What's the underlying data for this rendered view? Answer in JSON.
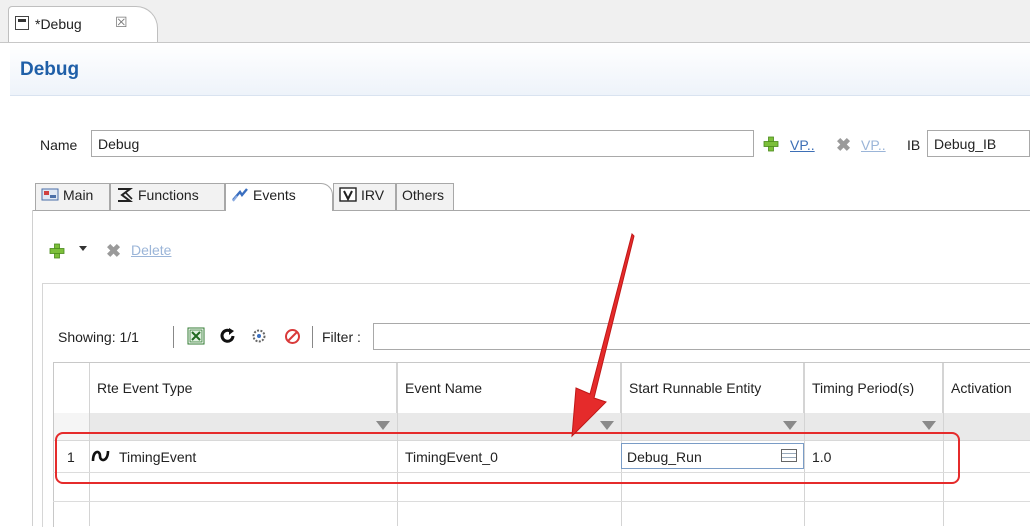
{
  "editor_tab": {
    "label": "*Debug",
    "close_glyph": "☒"
  },
  "title": "Debug",
  "name_row": {
    "name_label": "Name",
    "name_value": "Debug",
    "vp_add_link": "VP..",
    "vp_remove_link": "VP..",
    "ib_label": "IB",
    "ib_value": "Debug_IB"
  },
  "tabs": [
    {
      "label": "Main",
      "icon": "main-icon"
    },
    {
      "label": "Functions",
      "icon": "functions-icon"
    },
    {
      "label": "Events",
      "icon": "events-icon",
      "active": true
    },
    {
      "label": "IRV",
      "icon": "irv-icon"
    },
    {
      "label": "Others",
      "icon": ""
    }
  ],
  "actions": {
    "delete_label": "Delete"
  },
  "toolbar": {
    "showing": "Showing: 1/1",
    "filter_label": "Filter :",
    "filter_value": ""
  },
  "table": {
    "columns": [
      "Rte Event Type",
      "Event Name",
      "Start Runnable Entity",
      "Timing Period(s)",
      "Activation"
    ],
    "rows": [
      {
        "index": "1",
        "type": "TimingEvent",
        "name": "TimingEvent_0",
        "runnable": "Debug_Run",
        "period": "1.0",
        "activation": ""
      }
    ]
  },
  "colors": {
    "title": "#1f5fa8",
    "link": "#3d6fb6",
    "highlight": "#e52b2b"
  }
}
